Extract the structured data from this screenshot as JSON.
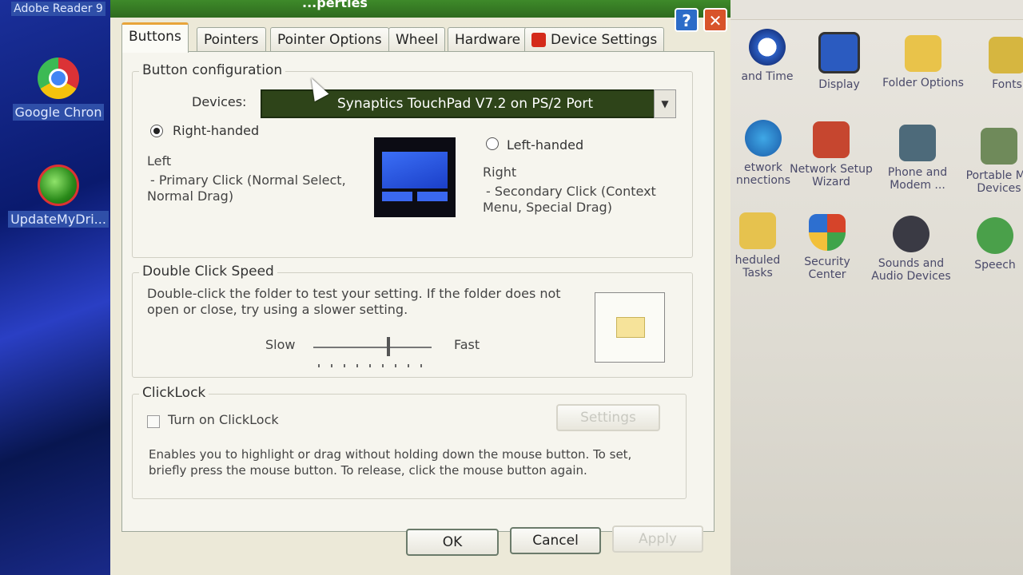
{
  "desktop": {
    "icons": [
      {
        "label": "Adobe Reader 9",
        "partial": "Adobe Read\n9"
      },
      {
        "label": "Google Chron"
      },
      {
        "label": "UpdateMyDri..."
      }
    ]
  },
  "dialog": {
    "title": "...perties",
    "help_label": "?",
    "close_label": "✕",
    "tabs": [
      {
        "label": "Buttons"
      },
      {
        "label": "Pointers"
      },
      {
        "label": "Pointer Options"
      },
      {
        "label": "Wheel"
      },
      {
        "label": "Hardware"
      },
      {
        "label": "Device Settings"
      }
    ],
    "button_config": {
      "title": "Button configuration",
      "devices_label": "Devices:",
      "devices_value": "Synaptics TouchPad V7.2 on PS/2 Port",
      "right_handed": "Right-handed",
      "left_handed": "Left-handed",
      "left_title": "Left",
      "left_desc": "- Primary Click (Normal Select,",
      "left_desc2": "Normal Drag)",
      "right_title": "Right",
      "right_desc": "- Secondary Click (Context",
      "right_desc2": "Menu, Special Drag)"
    },
    "double_click": {
      "title": "Double Click Speed",
      "desc1": "Double-click the folder to test your setting.  If the folder does not",
      "desc2": "open or close, try using a slower setting.",
      "slow": "Slow",
      "fast": "Fast"
    },
    "clicklock": {
      "title": "ClickLock",
      "checkbox_label": "Turn on ClickLock",
      "settings_label": "Settings",
      "desc1": "Enables you to highlight or drag without holding down the mouse button.  To set,",
      "desc2": "briefly press the mouse button.  To release, click the mouse button again."
    },
    "buttons": {
      "ok": "OK",
      "cancel": "Cancel",
      "apply": "Apply"
    }
  },
  "control_panel": {
    "items": [
      {
        "label": "and Time"
      },
      {
        "label": "Display"
      },
      {
        "label": "Folder Options"
      },
      {
        "label": "Fonts"
      },
      {
        "label": "etwork\nnnections"
      },
      {
        "label": "Network Setup\nWizard"
      },
      {
        "label": "Phone and\nModem ..."
      },
      {
        "label": "Portable Me\nDevices"
      },
      {
        "label": "heduled\nTasks"
      },
      {
        "label": "Security\nCenter"
      },
      {
        "label": "Sounds and\nAudio Devices"
      },
      {
        "label": "Speech"
      }
    ]
  }
}
